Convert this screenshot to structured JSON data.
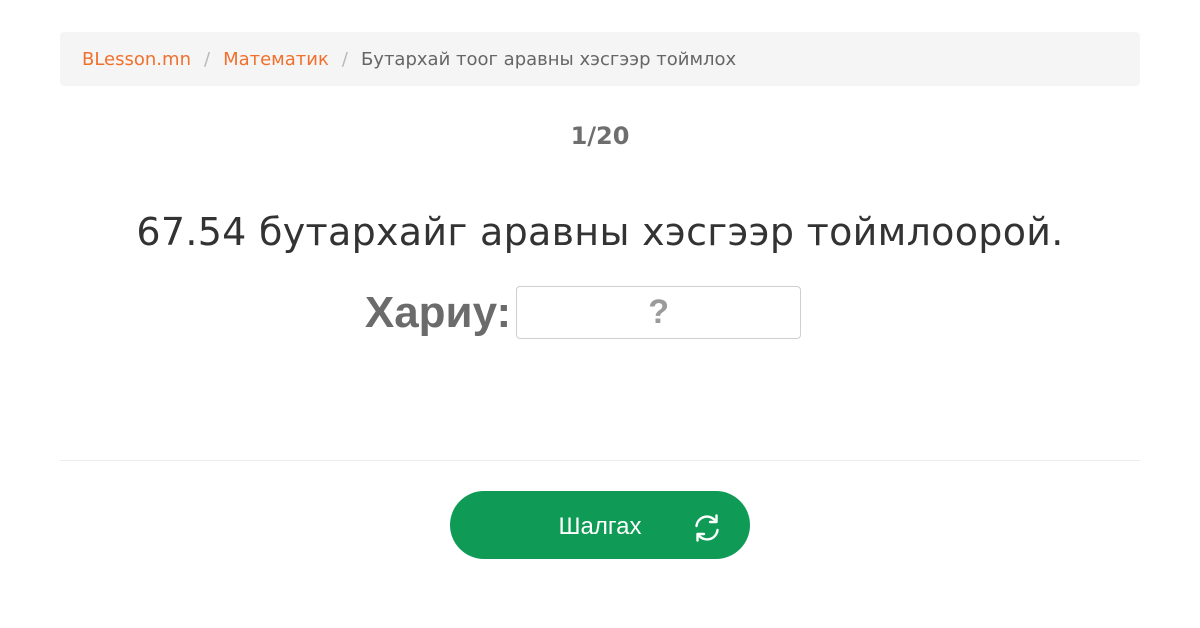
{
  "breadcrumb": {
    "items": [
      {
        "label": "BLesson.mn"
      },
      {
        "label": "Математик"
      }
    ],
    "separator": "/",
    "current": "Бутархай тоог аравны хэсгээр тоймлох"
  },
  "progress": {
    "counter": "1/20"
  },
  "question": {
    "text": "67.54 бутархайг аравны хэсгээр тоймлоорой."
  },
  "answer": {
    "label": "Хариу:",
    "value": "",
    "placeholder": "?"
  },
  "actions": {
    "check_label": "Шалгах",
    "check_icon": "refresh-icon"
  },
  "colors": {
    "link": "#f0702d",
    "button": "#0f9b56",
    "breadcrumb_bg": "#f5f5f5"
  }
}
